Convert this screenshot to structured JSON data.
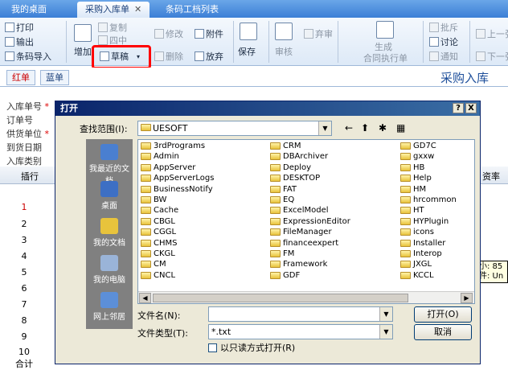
{
  "tabs": [
    {
      "label": "我的桌面"
    },
    {
      "label": "采购入库单"
    },
    {
      "label": "条码工档列表"
    }
  ],
  "ribbon": {
    "print": "打印",
    "export": "输出",
    "import": "条码导入",
    "add": "增加",
    "copy": "复制",
    "middle": "四中",
    "draft": "草稿",
    "modify": "修改",
    "delete": "删除",
    "attach": "附件",
    "abandon": "放弃",
    "save": "保存",
    "audit": "审核",
    "discard": "弃审",
    "generate": "生成",
    "generate_sub": "合同执行单",
    "approve": "批斥",
    "discuss": "讨论",
    "notify": "通知",
    "prev_page": "上一张",
    "next_page": "下一张"
  },
  "subtabs": {
    "red": "红单",
    "blue": "蓝单"
  },
  "doc_title": "采购入库",
  "form_labels": [
    "入库单号",
    "订单号",
    "供货单位",
    "到货日期",
    "入库类别"
  ],
  "grid": {
    "header_left": "插行",
    "header_right": "资率",
    "rows": [
      "1",
      "2",
      "3",
      "4",
      "5",
      "6",
      "7",
      "8",
      "9",
      "10"
    ],
    "footer": "合计"
  },
  "dialog": {
    "title": "打开",
    "help_btn": "?",
    "close_btn": "X",
    "lookin_label": "查找范围(I):",
    "lookin_value": "UESOFT",
    "places": [
      "我最近的文档",
      "桌面",
      "我的文档",
      "我的电脑",
      "网上邻居"
    ],
    "files_col1": [
      "3rdPrograms",
      "Admin",
      "AppServer",
      "AppServerLogs",
      "BusinessNotify",
      "BW",
      "Cache",
      "CBGL",
      "CGGL",
      "CHMS",
      "CKGL",
      "CM",
      "CNCL"
    ],
    "files_col2": [
      "CRM",
      "DBArchiver",
      "Deploy",
      "DESKTOP",
      "FAT",
      "EQ",
      "ExcelModel",
      "ExpressionEditor",
      "FileManager",
      "financeexpert",
      "FM",
      "Framework",
      "GDF"
    ],
    "files_col3": [
      "GD7C",
      "gxxw",
      "HB",
      "Help",
      "HM",
      "hrcommon",
      "HT",
      "HYPlugin",
      "icons",
      "Installer",
      "Interop",
      "JXGL",
      "KCCL"
    ],
    "filename_label": "文件名(N):",
    "filename_value": "",
    "filetype_label": "文件类型(T):",
    "filetype_value": "*.txt",
    "readonly_label": "以只读方式打开(R)",
    "open_btn": "打开(O)",
    "cancel_btn": "取消"
  },
  "tooltip": {
    "line1": "大小: 85",
    "line2": "文件: Un"
  }
}
